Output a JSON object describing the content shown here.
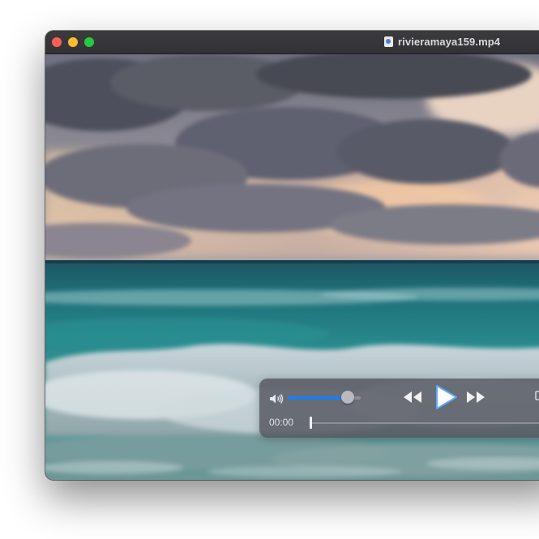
{
  "window": {
    "title": "rivieramaya159.mp4",
    "file_icon": "quicktime-file-icon"
  },
  "traffic_lights": {
    "close_color": "#fe5f57",
    "minimize_color": "#febc2e",
    "zoom_color": "#28c840"
  },
  "player": {
    "current_time": "00:00",
    "volume_level": 0.82,
    "playback_progress": 0.0,
    "accent_color": "#1f7cf4",
    "icons": [
      "volume-icon",
      "rewind-icon",
      "play-icon",
      "fast-forward-icon",
      "picture-in-picture-icon"
    ]
  }
}
